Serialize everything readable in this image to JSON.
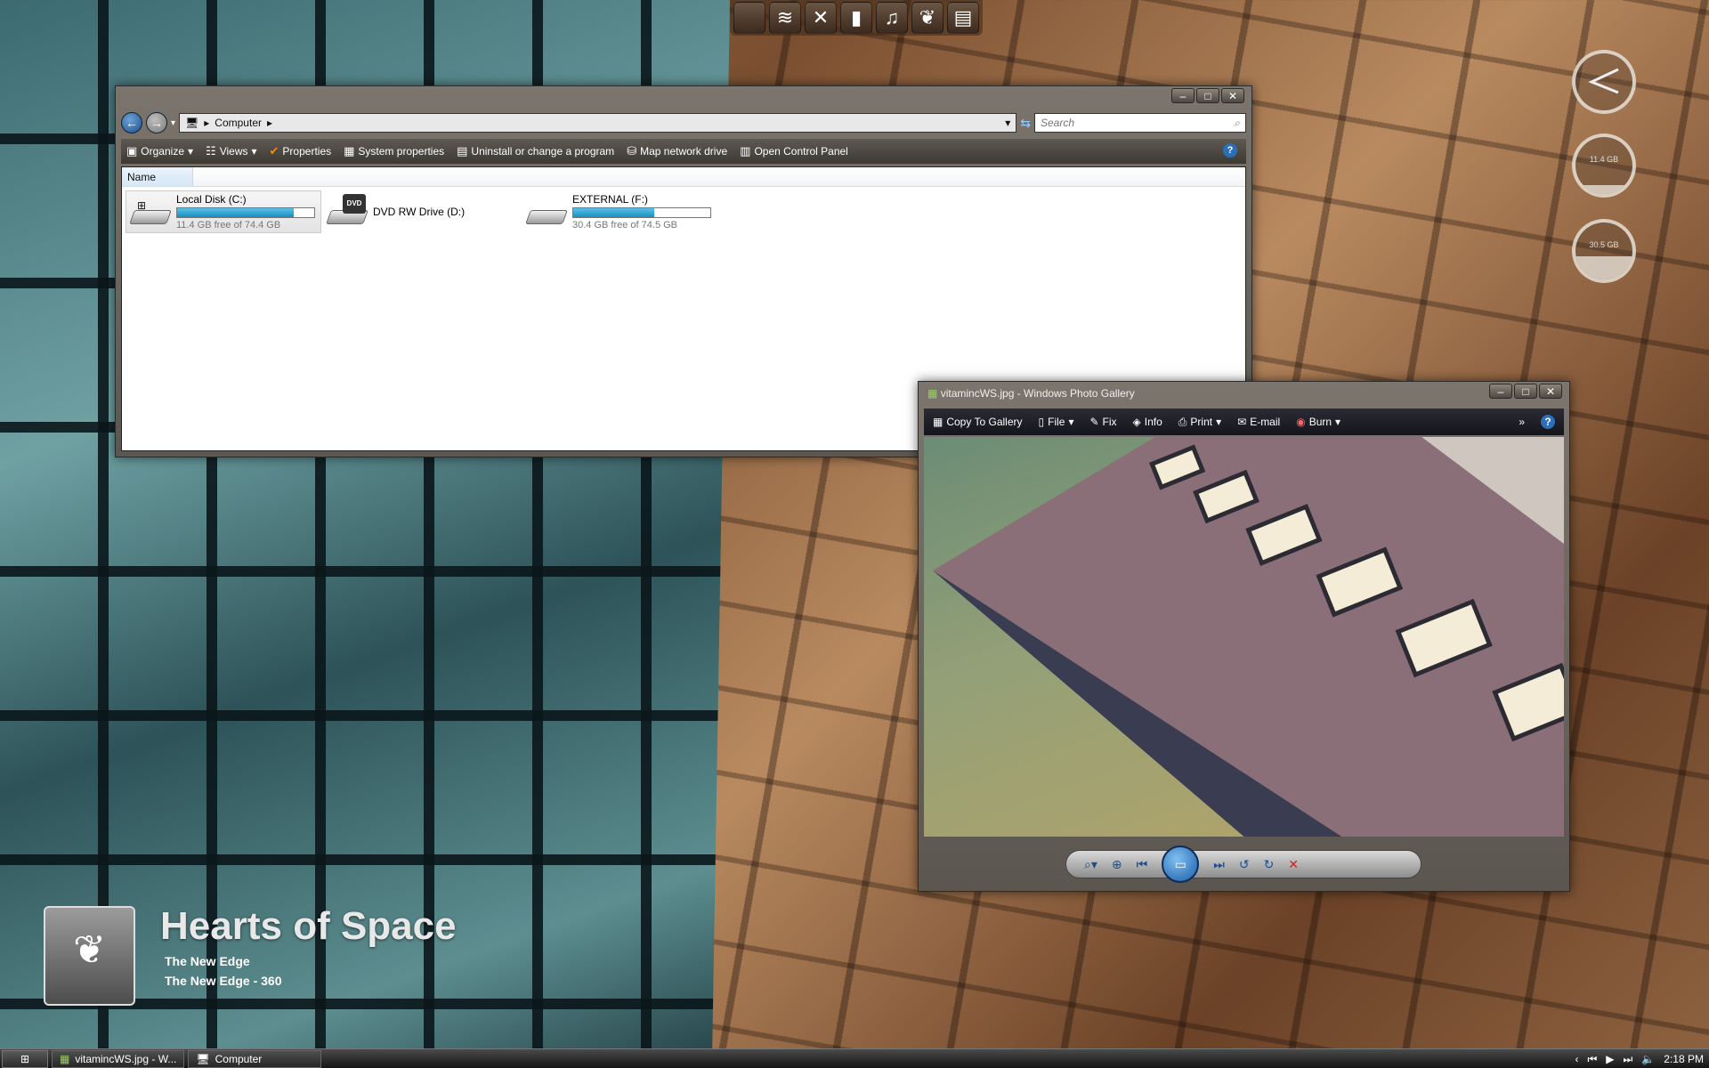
{
  "dock": {
    "items": [
      {
        "icon": "apple-icon",
        "glyph": ""
      },
      {
        "icon": "wifi-icon",
        "glyph": "≋"
      },
      {
        "icon": "tools-icon",
        "glyph": "✕"
      },
      {
        "icon": "trash-icon",
        "glyph": "▮"
      },
      {
        "icon": "music-icon",
        "glyph": "♫"
      },
      {
        "icon": "finder-icon",
        "glyph": "❦"
      },
      {
        "icon": "notes-icon",
        "glyph": "▤"
      }
    ]
  },
  "gauges": [
    {
      "label": "",
      "fill": 0.0
    },
    {
      "label": "11.4 GB",
      "fill": 0.15
    },
    {
      "label": "30.5 GB",
      "fill": 0.4
    }
  ],
  "explorer": {
    "breadcrumb": "Computer",
    "search_placeholder": "Search",
    "toolbar": [
      "Organize",
      "Views",
      "Properties",
      "System properties",
      "Uninstall or change a program",
      "Map network drive",
      "Open Control Panel"
    ],
    "column": "Name",
    "drives": [
      {
        "name": "Local Disk (C:)",
        "free": "11.4 GB free of 74.4 GB",
        "used_fraction": 0.85
      },
      {
        "name": "DVD RW Drive (D:)"
      },
      {
        "name": "EXTERNAL (F:)",
        "free": "30.4 GB free of 74.5 GB",
        "used_fraction": 0.59
      }
    ]
  },
  "gallery": {
    "title": "vitamincWS.jpg - Windows Photo Gallery",
    "toolbar": [
      "Copy To Gallery",
      "File",
      "Fix",
      "Info",
      "Print",
      "E-mail",
      "Burn"
    ]
  },
  "now_playing": {
    "title": "Hearts of Space",
    "album": "The New Edge",
    "track": "The New Edge - 360"
  },
  "taskbar": {
    "tasks": [
      "vitamincWS.jpg - W...",
      "Computer"
    ],
    "time": "2:18 PM"
  }
}
